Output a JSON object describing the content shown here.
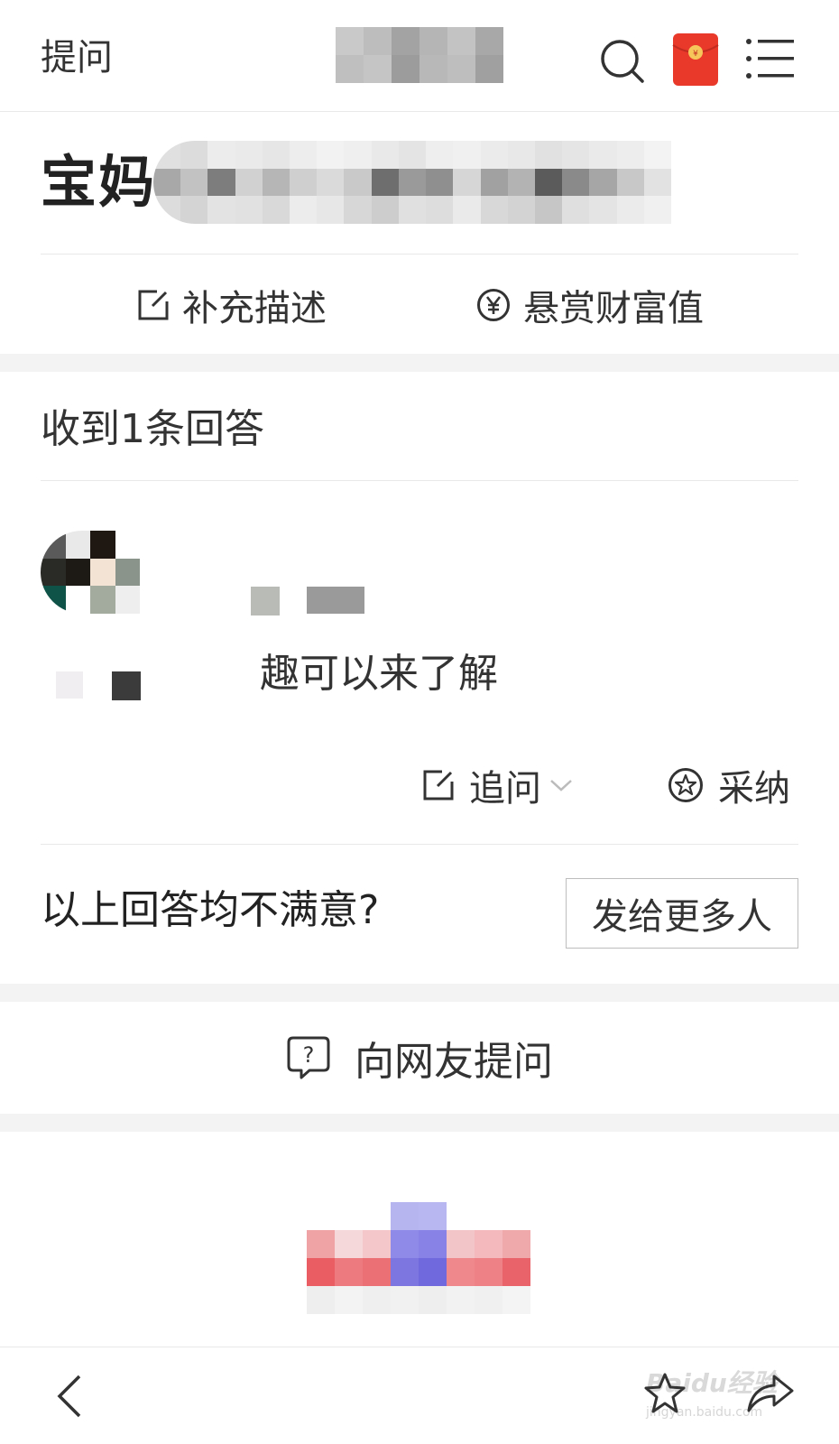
{
  "header": {
    "title": "提问"
  },
  "question": {
    "title_visible": "宝妈",
    "supplement_label": "补充描述",
    "reward_label": "悬赏财富值"
  },
  "answers": {
    "count_label": "收到1条回答",
    "items": [
      {
        "text_visible": "趣可以来了解",
        "follow_up_label": "追问",
        "adopt_label": "采纳"
      }
    ]
  },
  "unsatisfied": {
    "label": "以上回答均不满意?",
    "button_label": "发给更多人"
  },
  "ask": {
    "label": "向网友提问"
  },
  "watermark": {
    "text": "Baidu经验",
    "sub": "jingyan.baidu.com"
  },
  "icons": {
    "search": "search-icon",
    "red_packet": "red-packet-icon",
    "menu": "menu-icon",
    "edit": "edit-icon",
    "yen": "yen-coin-icon",
    "star_circle": "star-circle-icon",
    "question_bubble": "question-bubble-icon",
    "back": "chevron-left-icon",
    "favorite": "star-icon",
    "share": "share-icon"
  },
  "colors": {
    "red_packet": "#e8392b",
    "red_packet_coin": "#f6c65b",
    "text_primary": "#333333",
    "divider": "#e9e9e9",
    "band": "#f3f3f3"
  }
}
